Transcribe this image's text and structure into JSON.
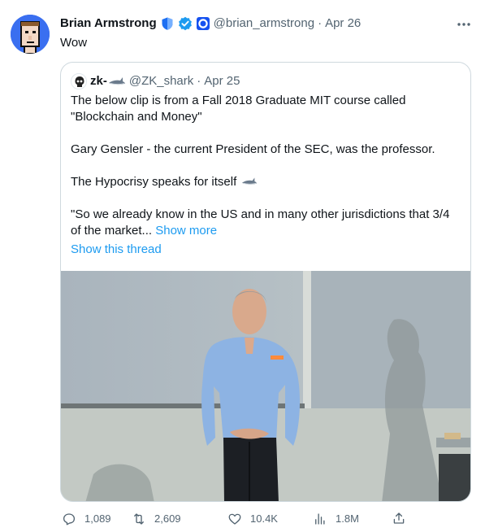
{
  "author": {
    "name": "Brian Armstrong",
    "handle": "@brian_armstrong",
    "separator": "·",
    "date": "Apr 26"
  },
  "tweet": {
    "text": "Wow"
  },
  "more_icon": "ellipsis-icon",
  "quote": {
    "name": "zk-",
    "name_emoji": "shark-icon",
    "handle": "@ZK_shark",
    "separator": "·",
    "date": "Apr 25",
    "line1": "The below clip is from a Fall 2018 Graduate MIT course called \"Blockchain and Money\"",
    "line2": "Gary Gensler - the current President of the SEC, was the professor.",
    "line3": "The Hypocrisy speaks for itself",
    "line3_emoji": "shark-icon",
    "line4": "\"So we already know in the US and in many other jurisdictions that 3/4 of the market...",
    "show_more": "Show more",
    "show_thread": "Show this thread",
    "media": "video-still-lecture"
  },
  "actions": {
    "replies": "1,089",
    "retweets": "2,609",
    "likes": "10.4K",
    "views": "1.8M"
  },
  "colors": {
    "link": "#1d9bf0",
    "secondary_text": "#536471",
    "border": "#cfd9de",
    "verified_blue": "#1d9bf0",
    "avatar_bg": "#3a6ff0"
  }
}
